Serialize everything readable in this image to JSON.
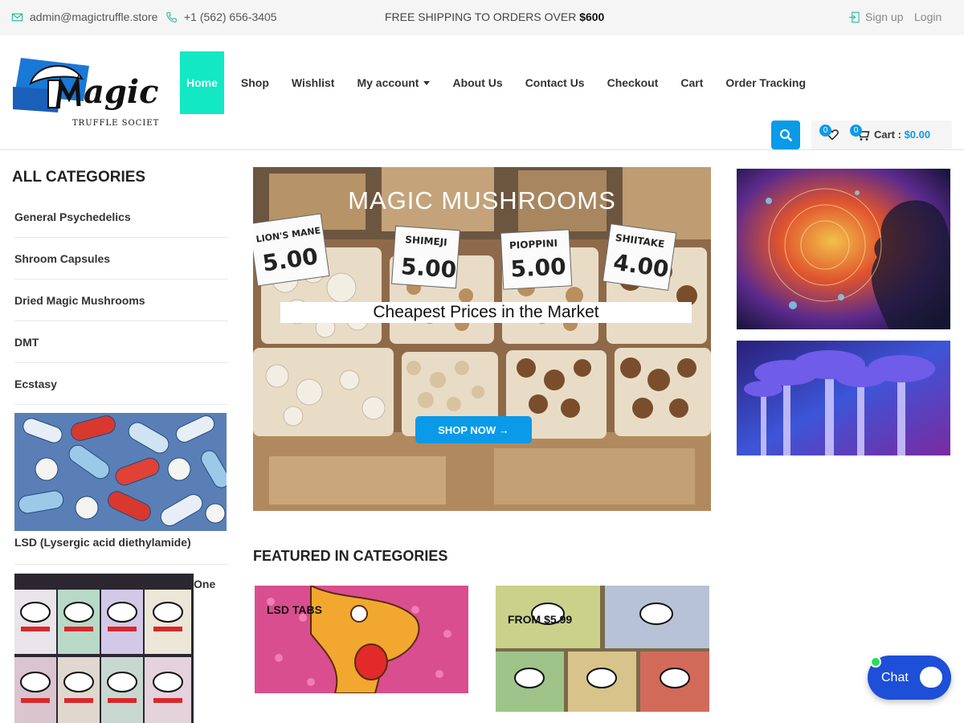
{
  "topbar": {
    "email": "admin@magictruffle.store",
    "phone": "+1 (562) 656-3405",
    "promo_text": "FREE SHIPPING TO ORDERS OVER",
    "promo_amount": "$600",
    "signup": "Sign up",
    "login": "Login"
  },
  "logo": {
    "text": "agic",
    "tagline": "TRUFFLE SOCIETY"
  },
  "nav": {
    "items": [
      "Home",
      "Shop",
      "Wishlist",
      "My account",
      "About Us",
      "Contact Us",
      "Checkout",
      "Cart",
      "Order Tracking"
    ],
    "active": "Home"
  },
  "header": {
    "wishlist_count": "0",
    "cart_count": "0",
    "cart_label": "Cart :",
    "cart_total": "$0.00"
  },
  "sidebar": {
    "title": "ALL CATEGORIES",
    "categories": [
      "General Psychedelics",
      "Shroom Capsules",
      "Dried Magic Mushrooms",
      "DMT",
      "Ecstasy"
    ],
    "image_caption_1": "LSD (Lysergic acid diethylamide)",
    "image_caption_2": "One"
  },
  "hero": {
    "title": "MAGIC MUSHROOMS",
    "subtitle": "Cheapest Prices in the Market",
    "button": "SHOP NOW →",
    "price_signs": [
      "LION'S MANE",
      "SHIMEJI",
      "PIOPPINI",
      "SHIITAKE"
    ],
    "prices": [
      "5.00",
      "5.00",
      "5.00",
      "4.00"
    ]
  },
  "featured": {
    "title": "FEATURED IN CATEGORIES",
    "card1_label": "LSD TABS",
    "card2_label": "FROM $5.99"
  },
  "chat": {
    "label": "Chat"
  },
  "colors": {
    "accent": "#0b9ae8",
    "nav_active": "#12e8c4",
    "chat": "#1d4fd8",
    "online": "#2bdc5b"
  },
  "icons": [
    "email-icon",
    "phone-icon",
    "signup-icon",
    "search-icon",
    "heart-icon",
    "cart-icon",
    "chat-icon"
  ]
}
